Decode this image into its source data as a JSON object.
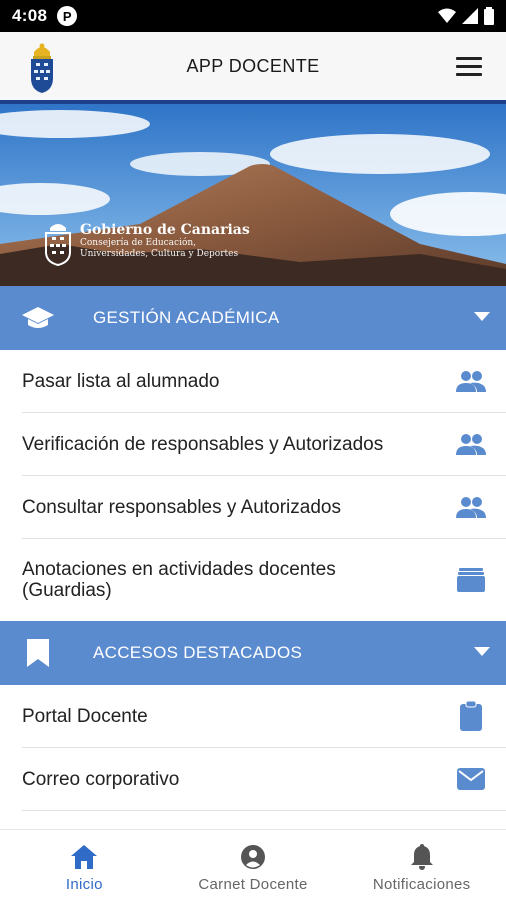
{
  "status_bar": {
    "time": "4:08",
    "app_badge": "P"
  },
  "header": {
    "title": "APP DOCENTE"
  },
  "banner": {
    "brand": "Gobierno de Canarias",
    "department_line1": "Consejería de Educación,",
    "department_line2": "Universidades, Cultura y Deportes"
  },
  "sections": [
    {
      "title": "GESTIÓN ACADÉMICA",
      "icon": "graduation-cap-icon",
      "items": [
        {
          "label": "Pasar lista al alumnado",
          "icon": "people-icon"
        },
        {
          "label": "Verificación de responsables y Autorizados",
          "icon": "people-icon"
        },
        {
          "label": "Consultar responsables y Autorizados",
          "icon": "people-icon"
        },
        {
          "label": "Anotaciones en actividades docentes (Guardias)",
          "icon": "folder-icon"
        }
      ]
    },
    {
      "title": "ACCESOS DESTACADOS",
      "icon": "bookmark-icon",
      "items": [
        {
          "label": "Portal Docente",
          "icon": "clipboard-icon"
        },
        {
          "label": "Correo corporativo",
          "icon": "mail-icon"
        }
      ]
    }
  ],
  "bottom_nav": [
    {
      "label": "Inicio",
      "icon": "home-icon",
      "active": true
    },
    {
      "label": "Carnet Docente",
      "icon": "account-circle-icon",
      "active": false
    },
    {
      "label": "Notificaciones",
      "icon": "bell-icon",
      "active": false
    }
  ],
  "colors": {
    "accent": "#5b8bcf",
    "icon_blue": "#5b8bcf",
    "active_nav": "#2f6bc7",
    "header_border": "#1e3f8a"
  }
}
